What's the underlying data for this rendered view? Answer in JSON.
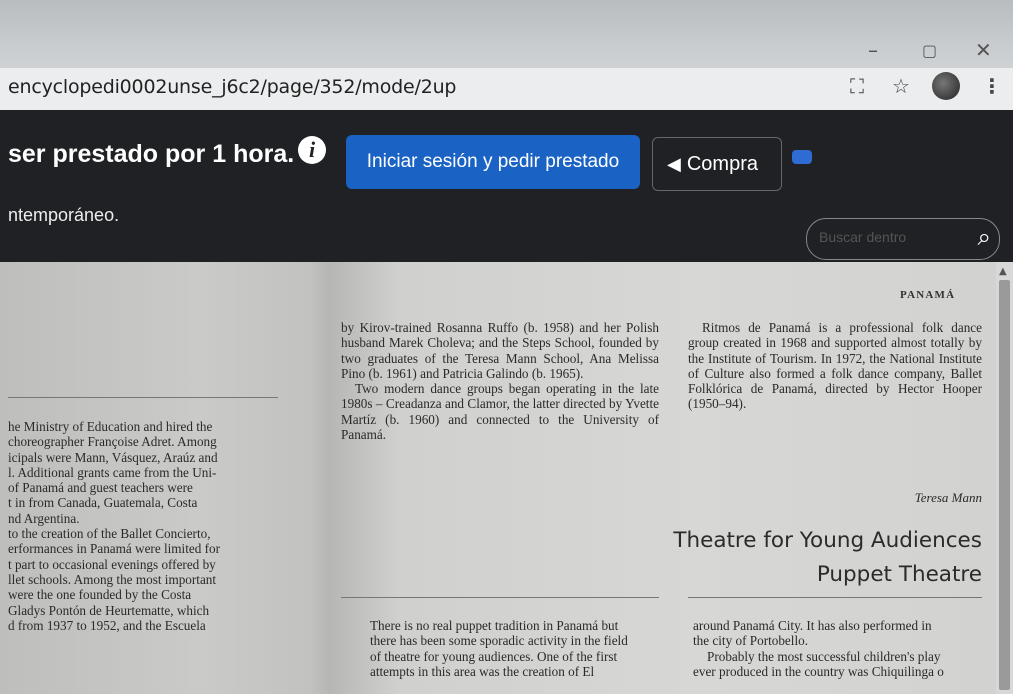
{
  "window": {
    "controls": {
      "minimize": "–",
      "maximize": "▢",
      "close": "✕"
    }
  },
  "addressbar": {
    "url": "encyclopedi0002unse_j6c2/page/352/mode/2up",
    "icons": [
      "translate-icon",
      "star-icon",
      "profile-icon",
      "menu-icon"
    ]
  },
  "banner": {
    "message": "ser prestado por 1 hora.",
    "info_symbol": "i",
    "borrow_button": "Iniciar sesión y pedir prestado",
    "buy_button": "Compra",
    "subtitle": "ntemporáneo.",
    "search_placeholder": "Buscar dentro",
    "colors": {
      "background": "#1f2124",
      "primary_button": "#1a63c4"
    }
  },
  "book": {
    "running_head": "PANAMÁ",
    "left_column": [
      "he Ministry of Education and hired the",
      " choreographer Françoise Adret. Among",
      "icipals were Mann, Vásquez, Araúz and",
      "l. Additional grants came from the Uni-",
      " of Panamá and guest teachers were",
      "t in from Canada, Guatemala, Costa",
      "nd Argentina.",
      " to the creation of the Ballet Concierto,",
      "erformances in Panamá were limited for",
      "t part to occasional evenings offered by",
      "llet schools. Among the most important",
      " were the one founded by the Costa",
      "Gladys Pontón de Heurtematte, which",
      "d from 1937 to 1952, and the Escuela"
    ],
    "middle_column": {
      "p1": "by Kirov-trained Rosanna Ruffo (b. 1958) and her Polish husband Marek Choleva; and the Steps School, founded by two graduates of the Teresa Mann School, Ana Melissa Pino (b. 1961) and Patricia Galindo (b. 1965).",
      "p2": "Two modern dance groups began operating in the late 1980s – Creadanza and Clamor, the latter directed by Yvette Martíz (b. 1960) and connected to the University of Panamá."
    },
    "right_column": {
      "p1": "Ritmos de Panamá is a professional folk dance group created in 1968 and supported almost totally by the Institute of Tourism. In 1972, the National Institute of Culture also formed a folk dance company, Ballet Folklórica de Panamá, directed by Hector Hooper (1950–94).",
      "byline": "Teresa Mann"
    },
    "heading_line1": "Theatre for Young Audiences",
    "heading_line2": "Puppet Theatre",
    "middle_bottom": [
      "There is no real puppet tradition in Panamá but",
      "there has been some sporadic activity in the field",
      "of theatre for young audiences. One of the first",
      "attempts in this area was the creation of El"
    ],
    "right_bottom": [
      "around Panamá City. It has also performed in",
      "the city of Portobello.",
      "Probably the most successful children's play",
      "ever produced in the country was Chiquilinga o"
    ]
  }
}
